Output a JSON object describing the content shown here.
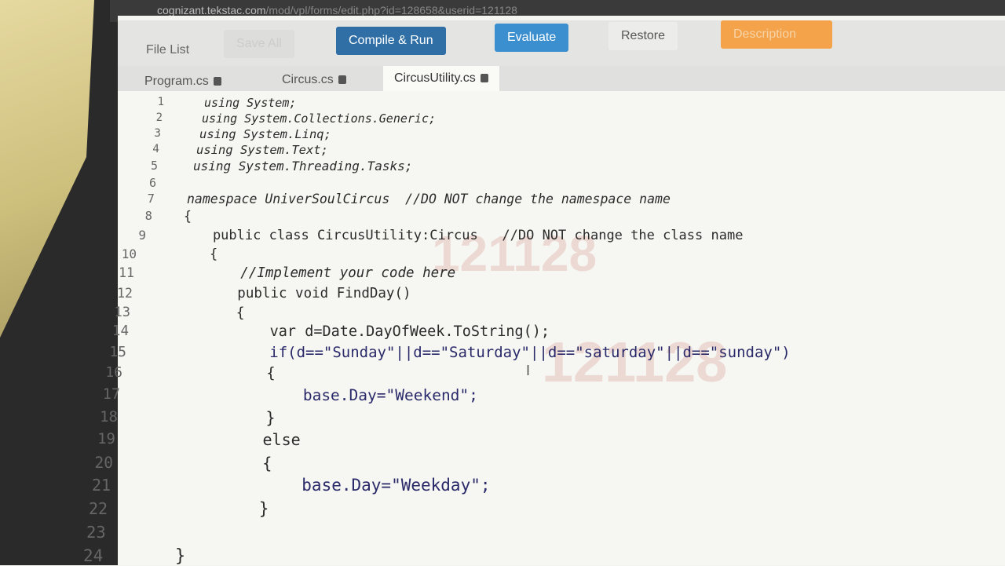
{
  "browser": {
    "url_host": "cognizant.tekstac.com",
    "url_path": "/mod/vpl/forms/edit.php?id=128658&userid=121128"
  },
  "toolbar": {
    "file_list": "File List",
    "save_all": "Save All",
    "compile_run": "Compile & Run",
    "evaluate": "Evaluate",
    "restore": "Restore",
    "description": "Description"
  },
  "tabs": [
    "Program.cs",
    "Circus.cs",
    "CircusUtility.cs"
  ],
  "watermark": "121128",
  "code": [
    {
      "n": "1",
      "t": "using System;"
    },
    {
      "n": "2",
      "t": "using System.Collections.Generic;"
    },
    {
      "n": "3",
      "t": "using System.Linq;"
    },
    {
      "n": "4",
      "t": "using System.Text;"
    },
    {
      "n": "5",
      "t": "using System.Threading.Tasks;"
    },
    {
      "n": "6",
      "t": ""
    },
    {
      "n": "7",
      "t": "namespace UniverSoulCircus  //DO NOT change the namespace name"
    },
    {
      "n": "8",
      "t": "{"
    },
    {
      "n": "9",
      "t": "    public class CircusUtility:Circus   //DO NOT change the class name"
    },
    {
      "n": "10",
      "t": "    {"
    },
    {
      "n": "11",
      "t": "        //Implement your code here"
    },
    {
      "n": "12",
      "t": "        public void FindDay()"
    },
    {
      "n": "13",
      "t": "        {"
    },
    {
      "n": "14",
      "t": "            var d=Date.DayOfWeek.ToString();"
    },
    {
      "n": "15",
      "t": "            if(d==\"Sunday\"||d==\"Saturday\"||d==\"saturday\"||d==\"sunday\")"
    },
    {
      "n": "16",
      "t": "            {"
    },
    {
      "n": "17",
      "t": "                base.Day=\"Weekend\";"
    },
    {
      "n": "18",
      "t": "            }"
    },
    {
      "n": "19",
      "t": "            else"
    },
    {
      "n": "20",
      "t": "            {"
    },
    {
      "n": "21",
      "t": "                base.Day=\"Weekday\";"
    },
    {
      "n": "22",
      "t": "            }"
    },
    {
      "n": "23",
      "t": ""
    },
    {
      "n": "24",
      "t": "    }"
    }
  ],
  "colors": {
    "compile": "#2f6fa6",
    "evaluate": "#3b8fcf",
    "description": "#f4a34a"
  }
}
